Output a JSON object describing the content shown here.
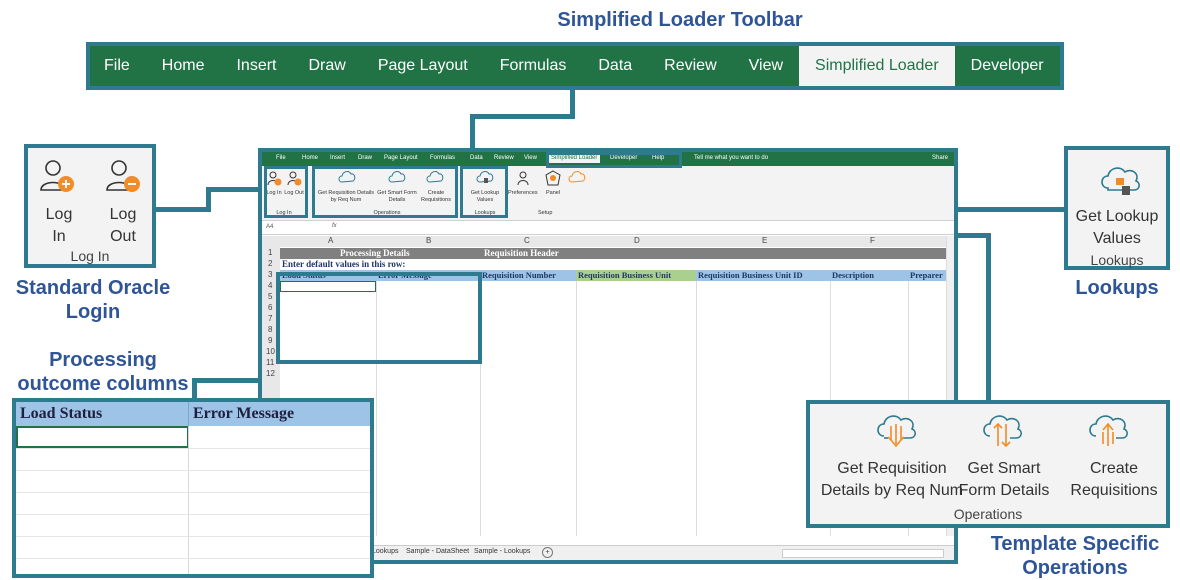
{
  "titles": {
    "toolbar": "Simplified Loader Toolbar",
    "login": "Standard Oracle Login",
    "processing": "Processing outcome columns",
    "lookups": "Lookups",
    "operations": "Template Specific Operations"
  },
  "ribbon": {
    "tabs": [
      "File",
      "Home",
      "Insert",
      "Draw",
      "Page Layout",
      "Formulas",
      "Data",
      "Review",
      "View",
      "Simplified Loader",
      "Developer",
      "Help"
    ],
    "active": "Simplified Loader"
  },
  "login_panel": {
    "login_label": "Log In",
    "login_short": "Log",
    "login_short2": "In",
    "logout_short": "Log",
    "logout_short2": "Out",
    "group": "Log In"
  },
  "lookups_panel": {
    "btn_line1": "Get Lookup",
    "btn_line2": "Values",
    "group": "Lookups"
  },
  "ops_panel": {
    "b1_l1": "Get Requisition",
    "b1_l2": "Details by Req Num",
    "b2_l1": "Get Smart",
    "b2_l2": "Form Details",
    "b3_l1": "Create",
    "b3_l2": "Requisitions",
    "group": "Operations"
  },
  "mini": {
    "tabs": [
      "File",
      "Home",
      "Insert",
      "Draw",
      "Page Layout",
      "Formulas",
      "Data",
      "Review",
      "View",
      "Simplified Loader",
      "Developer",
      "Help"
    ],
    "tell_me": "Tell me what you want to do",
    "share": "Share",
    "ribbon": {
      "log_in": "Log In",
      "log_out": "Log Out",
      "grp_login": "Log In",
      "op1": "Get Requisition Details by Req Num",
      "op2": "Get Smart Form Details",
      "op3": "Create Requisitions",
      "grp_ops": "Operations",
      "lookup": "Get Lookup Values",
      "grp_lookups": "Lookups",
      "prefs": "Preferences",
      "panel": "Panel",
      "grp_setup": "Setup"
    },
    "namebox": "A4",
    "fx": "fx",
    "cols": [
      "A",
      "B",
      "C",
      "D",
      "E",
      "F"
    ],
    "row1_a": "Processing Details",
    "row1_c": "Requisition Header",
    "row2": "Enter default values in this row:",
    "headers": [
      "Load Status",
      "Error Message",
      "Requisition Number",
      "Requisition Business Unit",
      "Requisition Business Unit ID",
      "Description",
      "Preparer"
    ],
    "rownums": [
      "1",
      "2",
      "3",
      "4",
      "5",
      "6",
      "7",
      "8",
      "9",
      "10",
      "11",
      "12"
    ],
    "sheets": [
      "Lookups",
      "Sample - DataSheet",
      "Sample - Lookups"
    ],
    "add_sheet": "+"
  },
  "zoom": {
    "col1": "Load Status",
    "col2": "Error Message"
  },
  "colors": {
    "teal": "#2e7a8f",
    "excel_green": "#217346",
    "title_blue": "#2f5597",
    "header_blue": "#9dc3e6",
    "header_green": "#a9d08e",
    "dark_gray": "#808080"
  }
}
